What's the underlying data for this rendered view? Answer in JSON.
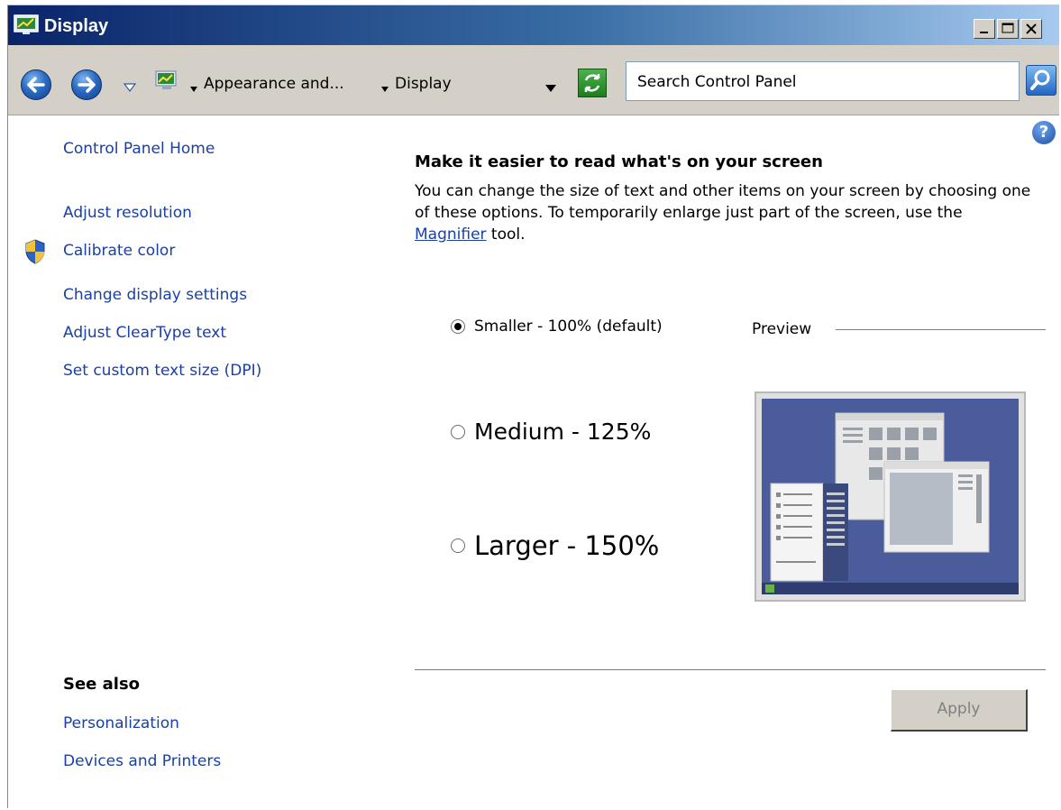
{
  "window": {
    "title": "Display"
  },
  "navbar": {
    "breadcrumbs": [
      "Appearance and...",
      "Display"
    ],
    "search_placeholder": "Search Control Panel"
  },
  "sidebar": {
    "home_link": "Control Panel Home",
    "tasks": [
      {
        "label": "Adjust resolution"
      },
      {
        "label": "Calibrate color",
        "icon": "shield-icon"
      },
      {
        "label": "Change display settings"
      },
      {
        "label": "Adjust ClearType text"
      },
      {
        "label": "Set custom text size (DPI)"
      }
    ],
    "see_also_heading": "See also",
    "see_also_links": [
      "Personalization",
      "Devices and Printers"
    ]
  },
  "main": {
    "heading": "Make it easier to read what's on your screen",
    "description_before": "You can change the size of text and other items on your screen by choosing one of these options. To temporarily enlarge just part of the screen, use the ",
    "description_link": "Magnifier",
    "description_after": " tool.",
    "options": [
      {
        "label": "Smaller - 100% (default)",
        "checked": true
      },
      {
        "label": "Medium - 125%",
        "checked": false
      },
      {
        "label": "Larger - 150%",
        "checked": false
      }
    ],
    "preview_label": "Preview",
    "apply_label": "Apply"
  },
  "colors": {
    "title_gradient_start": "#0a246a",
    "title_gradient_end": "#a6caf0",
    "link": "#1a3fa5",
    "chrome": "#d4d0c8"
  }
}
